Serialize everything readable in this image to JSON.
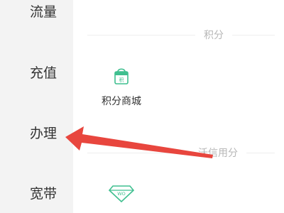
{
  "sidebar": {
    "items": [
      {
        "label": "流量"
      },
      {
        "label": "充值"
      },
      {
        "label": "办理"
      },
      {
        "label": "宽带"
      }
    ]
  },
  "sections": {
    "points": {
      "header": "积分",
      "tiles": [
        {
          "label": "积分商城",
          "icon": "bag-icon",
          "icon_text": "积"
        }
      ]
    },
    "wo_credit": {
      "header": "沃信用分",
      "tiles": [
        {
          "label": "",
          "icon": "diamond-icon",
          "icon_text": "WO"
        }
      ]
    }
  },
  "colors": {
    "accent": "#3fbf8f",
    "arrow": "#e8463e",
    "sidebar_bg": "#f3f3f3"
  }
}
